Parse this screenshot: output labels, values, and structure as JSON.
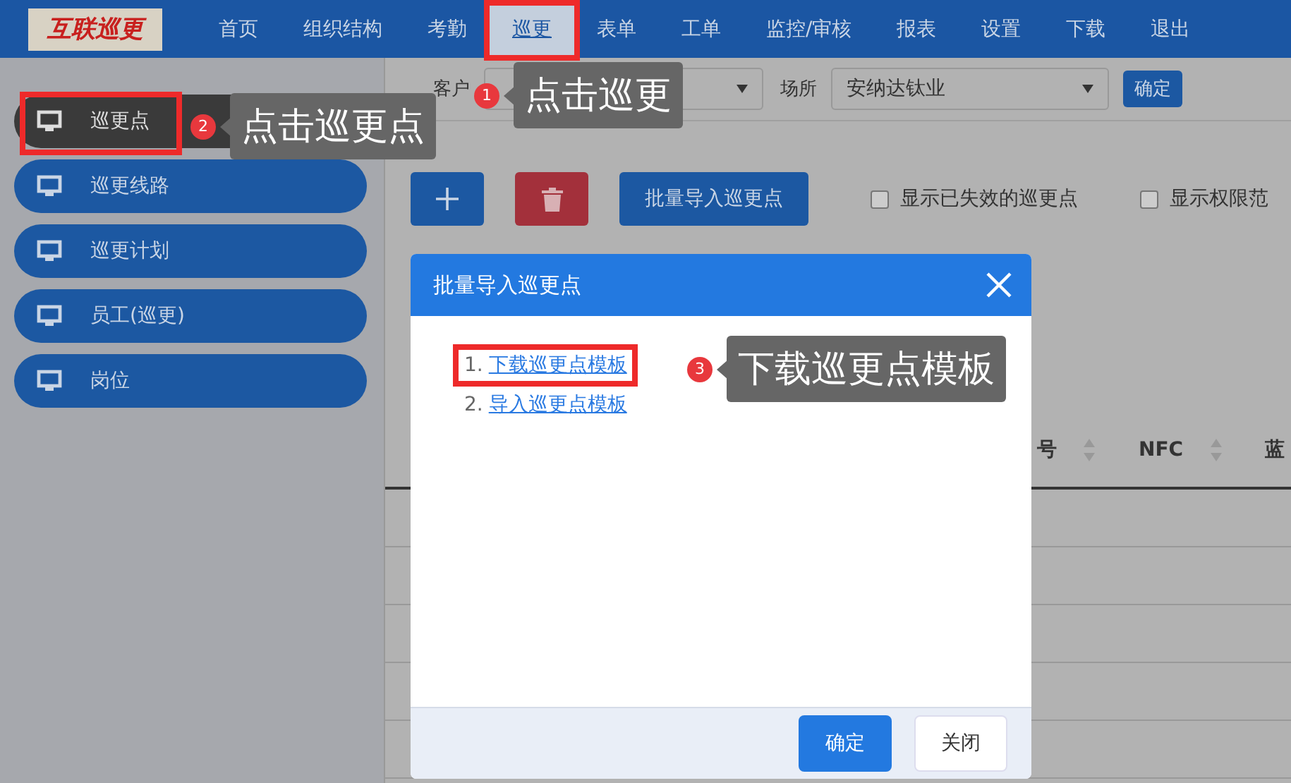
{
  "nav": {
    "logo": "互联巡更",
    "items": [
      {
        "label": "首页",
        "selected": false,
        "highlighted": false
      },
      {
        "label": "组织结构",
        "selected": false,
        "highlighted": false
      },
      {
        "label": "考勤",
        "selected": false,
        "highlighted": false
      },
      {
        "label": "巡更",
        "selected": true,
        "highlighted": true
      },
      {
        "label": "表单",
        "selected": false,
        "highlighted": false
      },
      {
        "label": "工单",
        "selected": false,
        "highlighted": false
      },
      {
        "label": "监控/审核",
        "selected": false,
        "highlighted": false
      },
      {
        "label": "报表",
        "selected": false,
        "highlighted": false
      },
      {
        "label": "设置",
        "selected": false,
        "highlighted": false
      },
      {
        "label": "下载",
        "selected": false,
        "highlighted": false
      },
      {
        "label": "退出",
        "selected": false,
        "highlighted": false
      }
    ]
  },
  "sidebar": {
    "items": [
      {
        "label": "巡更点",
        "selected": true,
        "highlighted": true
      },
      {
        "label": "巡更线路",
        "selected": false,
        "highlighted": false
      },
      {
        "label": "巡更计划",
        "selected": false,
        "highlighted": false
      },
      {
        "label": "员工(巡更)",
        "selected": false,
        "highlighted": false
      },
      {
        "label": "岗位",
        "selected": false,
        "highlighted": false
      }
    ]
  },
  "filters": {
    "customer_label": "客户",
    "site_label": "场所",
    "site_value": "安纳达钛业",
    "confirm": "确定"
  },
  "toolbar": {
    "import_button": "批量导入巡更点",
    "checkboxes": [
      {
        "label": "显示已失效的巡更点",
        "checked": false
      },
      {
        "label": "显示权限范",
        "checked": false
      }
    ]
  },
  "table": {
    "columns": [
      "号",
      "NFC",
      "蓝"
    ]
  },
  "modal": {
    "title": "批量导入巡更点",
    "links": [
      {
        "number": "1.",
        "text": "下载巡更点模板",
        "highlighted": true
      },
      {
        "number": "2.",
        "text": "导入巡更点模板",
        "highlighted": false
      }
    ],
    "buttons": [
      {
        "label": "确定",
        "kind": "primary"
      },
      {
        "label": "关闭",
        "kind": "default"
      }
    ]
  },
  "annotations": [
    {
      "number": "1",
      "text": "点击巡更"
    },
    {
      "number": "2",
      "text": "点击巡更点"
    },
    {
      "number": "3",
      "text": "下载巡更点模板"
    }
  ]
}
